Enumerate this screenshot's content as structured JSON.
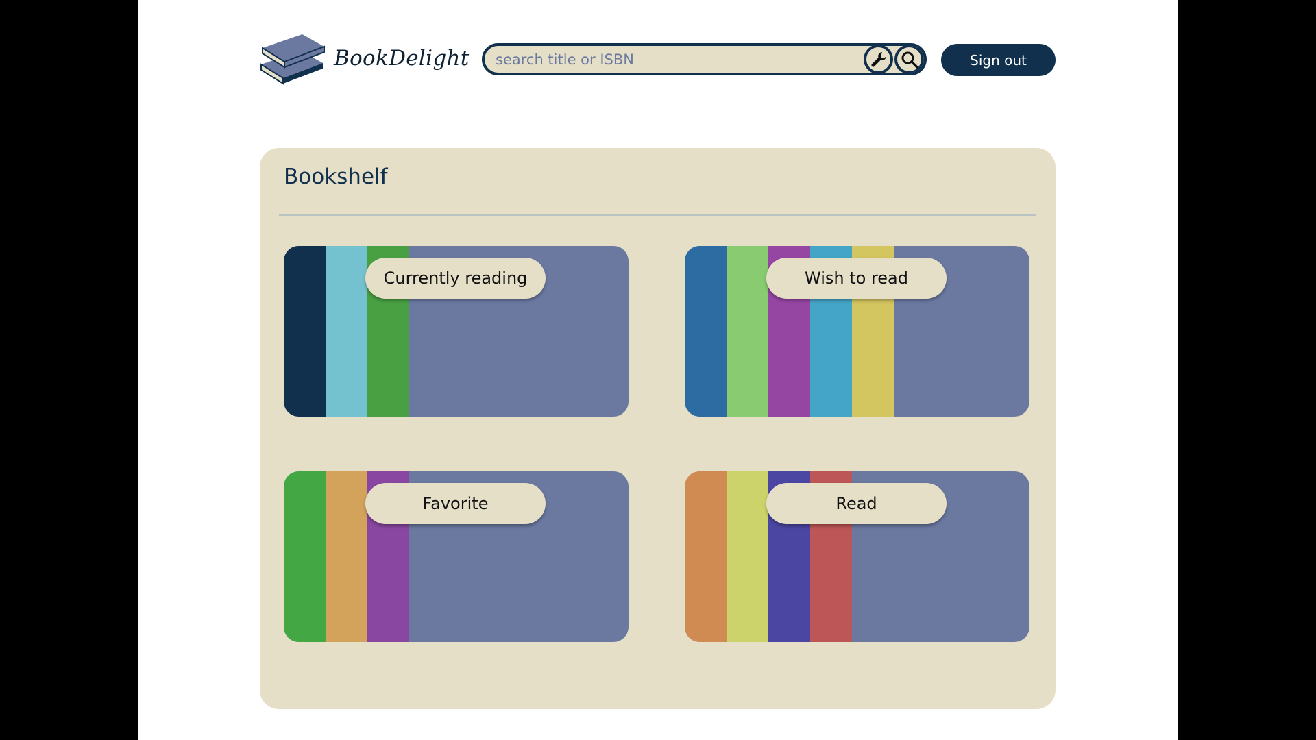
{
  "header": {
    "logo_text": "BookDelight",
    "search": {
      "placeholder": "search title or ISBN",
      "value": ""
    },
    "advanced_search_icon": "wrench-icon",
    "search_icon": "magnifier-icon",
    "signout_label": "Sign out"
  },
  "bookshelf": {
    "title": "Bookshelf",
    "shelves": [
      {
        "label": "Currently reading",
        "spine_colors": [
          "#10304d",
          "#74c2cf",
          "#49a043"
        ]
      },
      {
        "label": "Wish to read",
        "spine_colors": [
          "#2d6ca3",
          "#88cb70",
          "#9546a3",
          "#45a5c8",
          "#d3c55f"
        ]
      },
      {
        "label": "Favorite",
        "spine_colors": [
          "#43a843",
          "#d3a35b",
          "#8947a1"
        ]
      },
      {
        "label": "Read",
        "spine_colors": [
          "#cf8b51",
          "#ccd36a",
          "#4b46a1",
          "#bd5657"
        ]
      }
    ],
    "shelf_background": "#6b79a1"
  },
  "colors": {
    "primary": "#10304d",
    "panel": "#e6dfc8",
    "page": "#ffffff",
    "outer": "#000000"
  }
}
